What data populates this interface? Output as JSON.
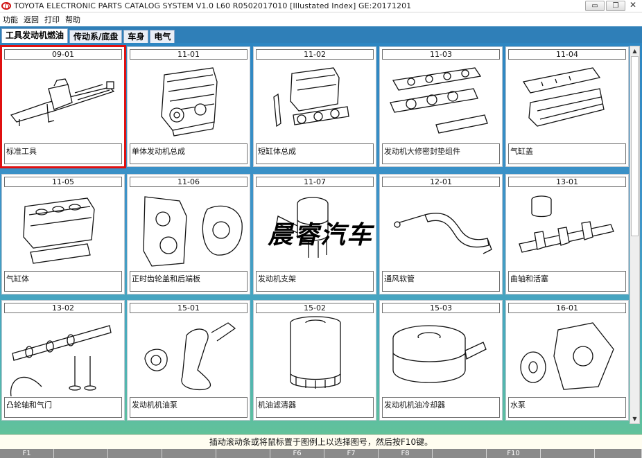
{
  "window": {
    "title": "TOYOTA ELECTRONIC PARTS CATALOG SYSTEM V1.0 L60 R0502017010 [Illustated Index] GE:20171201",
    "logo_icon": "toyota-logo-icon",
    "minimize_glyph": "▭",
    "restore_glyph": "❐",
    "close_glyph": "✕"
  },
  "menu": [
    "功能",
    "返回",
    "打印",
    "帮助"
  ],
  "tabs": [
    {
      "label": "工具发动机燃油",
      "active": true
    },
    {
      "label": "传动系/底盘",
      "active": false
    },
    {
      "label": "车身",
      "active": false
    },
    {
      "label": "电气",
      "active": false
    }
  ],
  "cards": [
    {
      "code": "09-01",
      "name": "标准工具",
      "icon": "jack-tool-icon",
      "selected": true
    },
    {
      "code": "11-01",
      "name": "单体发动机总成",
      "icon": "engine-assembly-icon"
    },
    {
      "code": "11-02",
      "name": "短缸体总成",
      "icon": "short-block-icon"
    },
    {
      "code": "11-03",
      "name": "发动机大修密封垫组件",
      "icon": "gasket-kit-icon"
    },
    {
      "code": "11-04",
      "name": "气缸盖",
      "icon": "cylinder-head-icon"
    },
    {
      "code": "11-05",
      "name": "气缸体",
      "icon": "cylinder-block-icon"
    },
    {
      "code": "11-06",
      "name": "正时齿轮盖和后端板",
      "icon": "timing-cover-icon"
    },
    {
      "code": "11-07",
      "name": "发动机支架",
      "icon": "engine-mount-icon"
    },
    {
      "code": "12-01",
      "name": "通风软管",
      "icon": "ventilation-hose-icon"
    },
    {
      "code": "13-01",
      "name": "曲轴和活塞",
      "icon": "crankshaft-piston-icon"
    },
    {
      "code": "13-02",
      "name": "凸轮轴和气门",
      "icon": "camshaft-valve-icon"
    },
    {
      "code": "15-01",
      "name": "发动机机油泵",
      "icon": "oil-pump-icon"
    },
    {
      "code": "15-02",
      "name": "机油滤清器",
      "icon": "oil-filter-icon"
    },
    {
      "code": "15-03",
      "name": "发动机机油冷却器",
      "icon": "oil-cooler-icon"
    },
    {
      "code": "16-01",
      "name": "水泵",
      "icon": "water-pump-icon"
    }
  ],
  "watermark": "晨睿汽车",
  "status": "插动滚动条或将鼠标置于图例上以选择图号，然后按F10键。",
  "fkeys": [
    "F1",
    "",
    "",
    "",
    "",
    "F6",
    "F7",
    "F8",
    "",
    "F10",
    "",
    ""
  ],
  "colors": {
    "selected_border": "#e01010",
    "content_bg": "#2d86c2",
    "status_bg": "#fffdf0"
  }
}
